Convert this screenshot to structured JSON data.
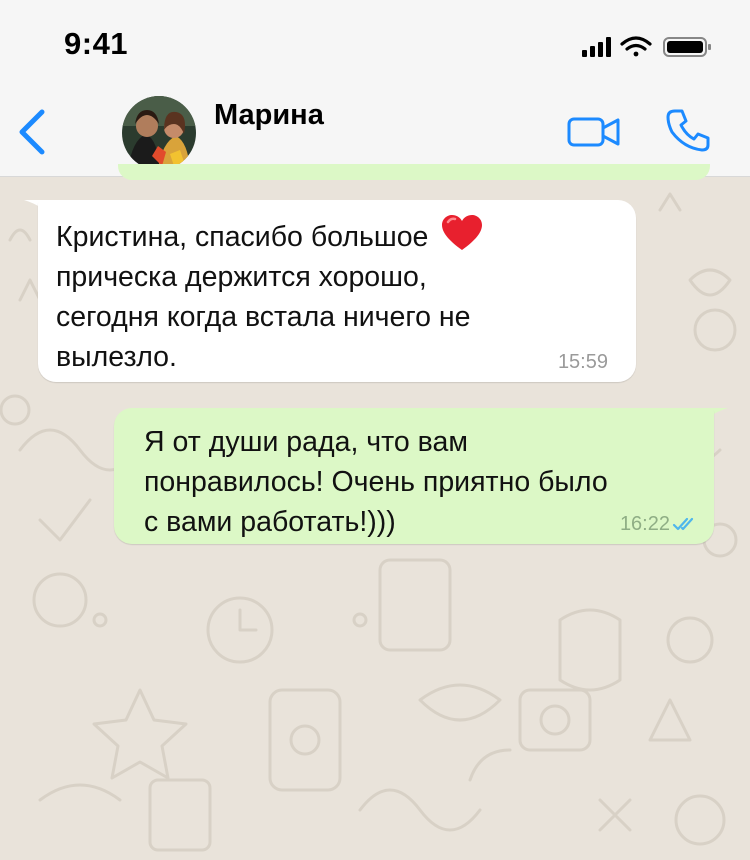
{
  "status_bar": {
    "time": "9:41"
  },
  "header": {
    "contact_name": "Марина"
  },
  "messages": [
    {
      "direction": "incoming",
      "lines": [
        "Кристина, спасибо большое",
        "прическа держится хорошо,",
        "сегодня когда встала ничего не",
        "вылезло."
      ],
      "emoji": "red-heart",
      "time": "15:59"
    },
    {
      "direction": "outgoing",
      "lines": [
        "Я от души рада, что вам",
        "понравилось! Очень приятно было",
        "с вами работать!)))"
      ],
      "time": "16:22",
      "status": "read"
    }
  ],
  "colors": {
    "accent": "#1c8aff",
    "outgoing_bubble": "#dcf8c6",
    "incoming_bubble": "#ffffff",
    "chat_background": "#e9e3da",
    "read_ticks": "#4fb6ec"
  },
  "icons": {
    "back": "chevron-left-icon",
    "video": "video-camera-icon",
    "call": "phone-icon",
    "signal": "cellular-signal-icon",
    "wifi": "wifi-icon",
    "battery": "battery-icon"
  }
}
